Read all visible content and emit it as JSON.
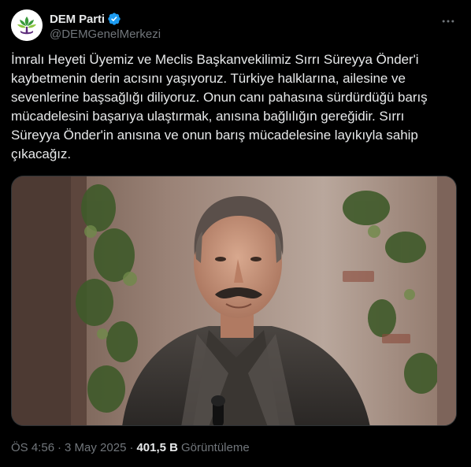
{
  "account": {
    "display_name": "DEM Parti",
    "handle": "@DEMGenelMerkezi",
    "verified": true
  },
  "icons": {
    "more": "more-horizontal-icon",
    "verified": "verified-badge-icon"
  },
  "colors": {
    "background": "#000000",
    "text": "#e7e9ea",
    "muted": "#71767b",
    "verified": "#1d9bf0",
    "logo_green": "#3a9a3c",
    "logo_purple": "#5b2a7a"
  },
  "tweet": {
    "text": "İmralı Heyeti Üyemiz ve Meclis Başkanvekilimiz Sırrı Süreyya Önder'i\nkaybetmenin derin acısını yaşıyoruz. Türkiye halklarına, ailesine ve\nsevenlerine başsağlığı diliyoruz. Onun canı pahasına sürdürdüğü barış\nmücadelesini başarıya ulaştırmak, anısına bağlılığın gereğidir. Sırrı\nSüreyya Önder'in anısına ve onun barış mücadelesine layıkıyla sahip\nçıkacağız."
  },
  "meta": {
    "time": "ÖS 4:56",
    "date": "3 May 2025",
    "separator": "·",
    "views_count": "401,5 B",
    "views_label": "Görüntüleme"
  }
}
